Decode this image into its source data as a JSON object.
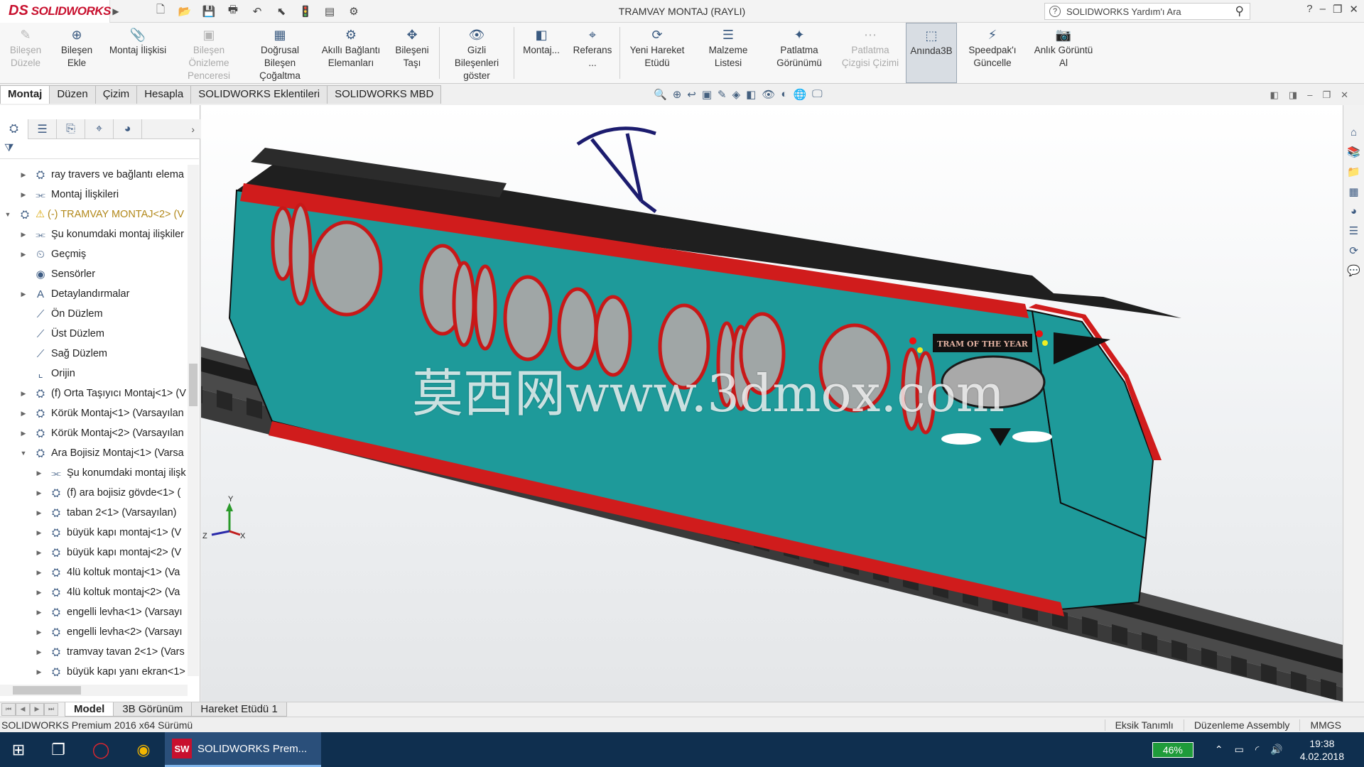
{
  "app": {
    "brand": "SOLIDWORKS",
    "brand_mark": "DS",
    "window_title": "TRAMVAY MONTAJ (RAYLI)",
    "help_search_placeholder": "SOLIDWORKS Yardım'ı Ara"
  },
  "ribbon": {
    "buttons": [
      {
        "label": "Bileşen Düzele",
        "state": "disabled",
        "icon": "edit-component-icon"
      },
      {
        "label": "Bileşen Ekle",
        "state": "normal",
        "icon": "insert-component-icon"
      },
      {
        "label": "Montaj İlişkisi",
        "state": "normal",
        "icon": "mate-icon"
      },
      {
        "label": "Bileşen Önizleme Penceresi",
        "state": "disabled",
        "icon": "component-preview-icon"
      },
      {
        "label": "Doğrusal Bileşen Çoğaltma",
        "state": "normal",
        "icon": "linear-pattern-icon"
      },
      {
        "label": "Akıllı Bağlantı Elemanları",
        "state": "normal",
        "icon": "smart-fasteners-icon"
      },
      {
        "label": "Bileşeni Taşı",
        "state": "normal",
        "icon": "move-component-icon"
      },
      {
        "label": "Gizli Bileşenleri göster",
        "state": "normal",
        "icon": "show-hidden-icon"
      },
      {
        "label": "Montaj...",
        "state": "normal",
        "icon": "assembly-features-icon"
      },
      {
        "label": "Referans ...",
        "state": "normal",
        "icon": "reference-geometry-icon"
      },
      {
        "label": "Yeni Hareket Etüdü",
        "state": "normal",
        "icon": "motion-study-icon"
      },
      {
        "label": "Malzeme Listesi",
        "state": "normal",
        "icon": "bill-of-materials-icon"
      },
      {
        "label": "Patlatma Görünümü",
        "state": "normal",
        "icon": "exploded-view-icon"
      },
      {
        "label": "Patlatma Çizgisi Çizimi",
        "state": "disabled",
        "icon": "explode-line-icon"
      },
      {
        "label": "Anında3B",
        "state": "active",
        "icon": "instant3d-icon"
      },
      {
        "label": "Speedpak'ı Güncelle",
        "state": "normal",
        "icon": "speedpak-icon"
      },
      {
        "label": "Anlık Görüntü Al",
        "state": "normal",
        "icon": "snapshot-icon"
      }
    ]
  },
  "tabs": [
    {
      "label": "Montaj",
      "active": true
    },
    {
      "label": "Düzen",
      "active": false
    },
    {
      "label": "Çizim",
      "active": false
    },
    {
      "label": "Hesapla",
      "active": false
    },
    {
      "label": "SOLIDWORKS Eklentileri",
      "active": false
    },
    {
      "label": "SOLIDWORKS MBD",
      "active": false
    }
  ],
  "tree": {
    "items": [
      {
        "label": "ray travers ve bağlantı elema",
        "icon": "assembly-icon",
        "level": 1,
        "expand": "collapsed"
      },
      {
        "label": "Montaj İlişkileri",
        "icon": "mates-folder-icon",
        "level": 1,
        "expand": "collapsed"
      },
      {
        "label": "(-) TRAMVAY MONTAJ<2> (V",
        "icon": "assembly-warning-icon",
        "level": 0,
        "expand": "expanded",
        "warn": true
      },
      {
        "label": "Şu konumdaki montaj ilişkiler",
        "icon": "mates-folder-icon",
        "level": 1,
        "expand": "collapsed"
      },
      {
        "label": "Geçmiş",
        "icon": "history-icon",
        "level": 1,
        "expand": "collapsed"
      },
      {
        "label": "Sensörler",
        "icon": "sensor-icon",
        "level": 1,
        "expand": "none"
      },
      {
        "label": "Detaylandırmalar",
        "icon": "annotations-icon",
        "level": 1,
        "expand": "collapsed"
      },
      {
        "label": "Ön Düzlem",
        "icon": "plane-icon",
        "level": 1,
        "expand": "none"
      },
      {
        "label": "Üst Düzlem",
        "icon": "plane-icon",
        "level": 1,
        "expand": "none"
      },
      {
        "label": "Sağ Düzlem",
        "icon": "plane-icon",
        "level": 1,
        "expand": "none"
      },
      {
        "label": "Orijin",
        "icon": "origin-icon",
        "level": 1,
        "expand": "none"
      },
      {
        "label": "(f) Orta Taşıyıcı Montaj<1> (V",
        "icon": "assembly-icon",
        "level": 1,
        "expand": "collapsed"
      },
      {
        "label": "Körük Montaj<1> (Varsayılan",
        "icon": "assembly-icon",
        "level": 1,
        "expand": "collapsed"
      },
      {
        "label": "Körük Montaj<2> (Varsayılan",
        "icon": "assembly-icon",
        "level": 1,
        "expand": "collapsed"
      },
      {
        "label": "Ara Bojisiz Montaj<1> (Varsa",
        "icon": "assembly-icon",
        "level": 1,
        "expand": "expanded"
      },
      {
        "label": "Şu konumdaki montaj ilişk",
        "icon": "mates-folder-icon",
        "level": 2,
        "expand": "collapsed"
      },
      {
        "label": "(f) ara bojisiz gövde<1> (",
        "icon": "assembly-icon",
        "level": 2,
        "expand": "collapsed"
      },
      {
        "label": "taban 2<1> (Varsayılan)",
        "icon": "assembly-icon",
        "level": 2,
        "expand": "collapsed"
      },
      {
        "label": "büyük kapı montaj<1> (V",
        "icon": "assembly-icon",
        "level": 2,
        "expand": "collapsed"
      },
      {
        "label": "büyük kapı montaj<2> (V",
        "icon": "assembly-icon",
        "level": 2,
        "expand": "collapsed"
      },
      {
        "label": "4lü koltuk montaj<1> (Va",
        "icon": "assembly-icon",
        "level": 2,
        "expand": "collapsed"
      },
      {
        "label": "4lü koltuk montaj<2> (Va",
        "icon": "assembly-icon",
        "level": 2,
        "expand": "collapsed"
      },
      {
        "label": "engelli levha<1> (Varsayı",
        "icon": "assembly-icon",
        "level": 2,
        "expand": "collapsed"
      },
      {
        "label": "engelli levha<2> (Varsayı",
        "icon": "assembly-icon",
        "level": 2,
        "expand": "collapsed"
      },
      {
        "label": "tramvay tavan 2<1> (Vars",
        "icon": "assembly-icon",
        "level": 2,
        "expand": "collapsed"
      },
      {
        "label": "büyük kapı yanı ekran<1>",
        "icon": "assembly-icon",
        "level": 2,
        "expand": "collapsed"
      }
    ]
  },
  "viewport": {
    "watermark": "莫西网www.3dmox.com",
    "tram_sign": "TRAM OF THE YEAR",
    "colors": {
      "body": "#1e9a9a",
      "trim": "#d01c1c",
      "roof": "#1c1c1c",
      "rail": "#2a2a2a"
    },
    "triad": {
      "y": "Y",
      "z": "Z",
      "x": "X"
    }
  },
  "model_tabs": [
    {
      "label": "Model",
      "active": true
    },
    {
      "label": "3B Görünüm",
      "active": false
    },
    {
      "label": "Hareket Etüdü 1",
      "active": false
    }
  ],
  "status": {
    "left": "SOLIDWORKS Premium 2016 x64 Sürümü",
    "definition": "Eksik Tanımlı",
    "mode": "Düzenleme Assembly",
    "units": "MMGS"
  },
  "taskbar": {
    "app_label": "SOLIDWORKS Prem...",
    "battery": "46%",
    "time": "19:38",
    "date": "4.02.2018"
  }
}
